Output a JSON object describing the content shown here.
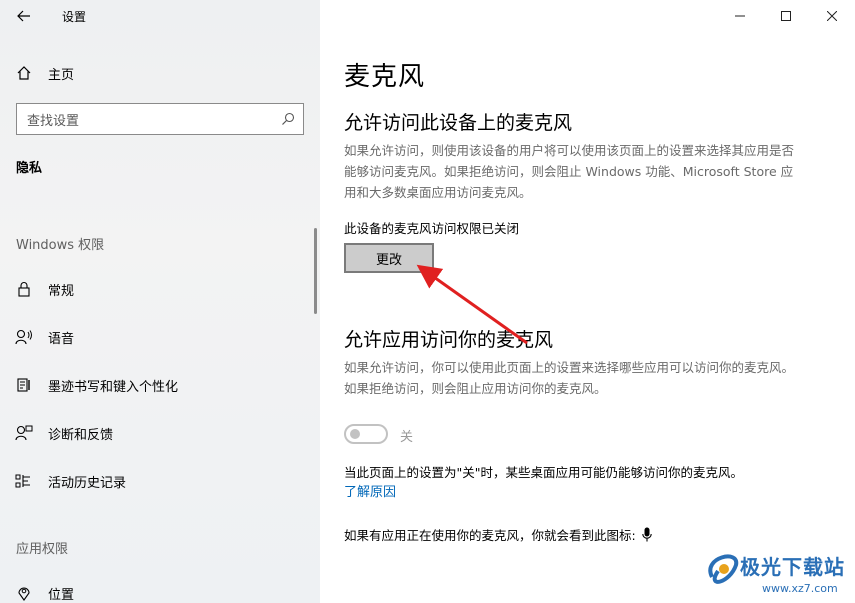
{
  "window": {
    "title": "设置",
    "back_icon": "arrow-left-icon",
    "controls": [
      "minimize",
      "maximize",
      "close"
    ]
  },
  "sidebar": {
    "home_label": "主页",
    "search_placeholder": "查找设置",
    "current_section": "隐私",
    "windows_permissions_header": "Windows 权限",
    "items": [
      {
        "label": "常规",
        "icon": "lock-icon"
      },
      {
        "label": "语音",
        "icon": "speech-icon"
      },
      {
        "label": "墨迹书写和键入个性化",
        "icon": "pen-keyboard-icon"
      },
      {
        "label": "诊断和反馈",
        "icon": "feedback-icon"
      },
      {
        "label": "活动历史记录",
        "icon": "activity-history-icon"
      }
    ],
    "app_permissions_header": "应用权限",
    "app_items": [
      {
        "label": "位置",
        "icon": "location-icon"
      }
    ]
  },
  "main": {
    "page_title": "麦克风",
    "section1": {
      "heading": "允许访问此设备上的麦克风",
      "description": "如果允许访问，则使用该设备的用户将可以使用该页面上的设置来选择其应用是否能够访问麦克风。如果拒绝访问，则会阻止 Windows 功能、Microsoft Store 应用和大多数桌面应用访问麦克风。",
      "status": "此设备的麦克风访问权限已关闭",
      "change_button": "更改"
    },
    "section2": {
      "heading": "允许应用访问你的麦克风",
      "description": "如果允许访问，你可以使用此页面上的设置来选择哪些应用可以访问你的麦克风。如果拒绝访问，则会阻止应用访问你的麦克风。",
      "toggle_state": "关",
      "toggle_on": false,
      "note": "当此页面上的设置为\"关\"时，某些桌面应用可能仍能够访问你的麦克风。",
      "learn_more": "了解原因",
      "mic_indicator_text": "如果有应用正在使用你的麦克风，你就会看到此图标:"
    }
  },
  "watermark": {
    "text": "极光下载站",
    "url": "www.xz7.com"
  },
  "colors": {
    "accent": "#0067b8",
    "arrow": "#e02020"
  }
}
